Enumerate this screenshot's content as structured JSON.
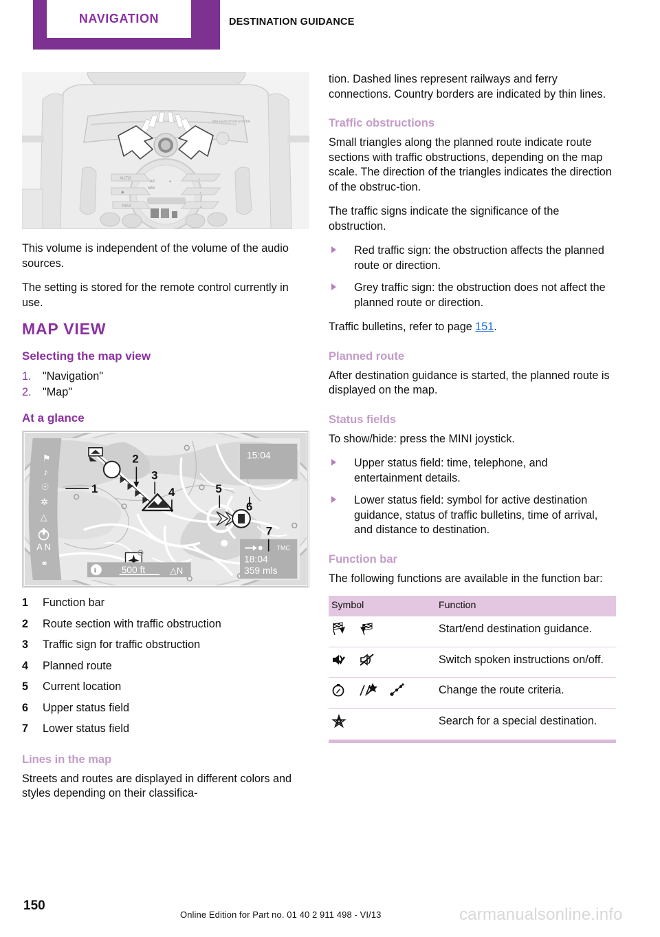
{
  "header": {
    "chapter": "NAVIGATION",
    "section": "DESTINATION GUIDANCE",
    "accent_color": "#7d3292",
    "heading_color": "#8a31a0",
    "subheading_color": "#c49bc8"
  },
  "left_column": {
    "figure_dashboard_caption": "",
    "paragraphs": [
      "This volume is independent of the volume of the audio sources.",
      "The setting is stored for the remote control currently in use."
    ],
    "h1": "MAP VIEW",
    "h2_selecting": "Selecting the map view",
    "steps": [
      {
        "num": "1.",
        "text": "\"Navigation\""
      },
      {
        "num": "2.",
        "text": "\"Map\""
      }
    ],
    "h2_glance": "At a glance",
    "map_image": {
      "upper_status_time": "15:04",
      "scale_label": "500 ft",
      "north_label": "N",
      "lower_status_tmc": "TMC",
      "lower_status_time": "18:04",
      "lower_status_distance": "359 mls",
      "callouts": [
        "1",
        "2",
        "3",
        "4",
        "5",
        "6",
        "7"
      ]
    },
    "legend": [
      {
        "num": "1",
        "label": "Function bar"
      },
      {
        "num": "2",
        "label": "Route section with traffic obstruction"
      },
      {
        "num": "3",
        "label": "Traffic sign for traffic obstruction"
      },
      {
        "num": "4",
        "label": "Planned route"
      },
      {
        "num": "5",
        "label": "Current location"
      },
      {
        "num": "6",
        "label": "Upper status field"
      },
      {
        "num": "7",
        "label": "Lower status field"
      }
    ],
    "h3_lines": "Lines in the map",
    "lines_paragraph": "Streets and routes are displayed in different colors and styles depending on their classifica-"
  },
  "right_column": {
    "continued_paragraph": "tion. Dashed lines represent railways and ferry connections. Country borders are indicated by thin lines.",
    "h3_traffic": "Traffic obstructions",
    "traffic_p1": "Small triangles along the planned route indicate route sections with traffic obstructions, depending on the map scale. The direction of the triangles indicates the direction of the obstruc-tion.",
    "traffic_p2": "The traffic signs indicate the significance of the obstruction.",
    "traffic_bullets": [
      "Red traffic sign: the obstruction affects the planned route or direction.",
      "Grey traffic sign: the obstruction does not affect the planned route or direction."
    ],
    "bulletins_prefix": "Traffic bulletins, refer to page ",
    "bulletins_page": "151",
    "bulletins_suffix": ".",
    "h3_planned": "Planned route",
    "planned_p": "After destination guidance is started, the planned route is displayed on the map.",
    "h3_status": "Status fields",
    "status_p": "To show/hide: press the MINI joystick.",
    "status_bullets": [
      "Upper status field: time, telephone, and entertainment details.",
      "Lower status field: symbol for active destination guidance, status of traffic bulletins, time of arrival, and distance to destination."
    ],
    "h3_function": "Function bar",
    "function_p": "The following functions are available in the function bar:",
    "table": {
      "headers": {
        "symbol": "Symbol",
        "function": "Function"
      },
      "rows": [
        {
          "symbols": [
            "checkered-flags-start-icon",
            "checkered-flags-end-icon"
          ],
          "function": "Start/end destination guidance."
        },
        {
          "symbols": [
            "speaker-on-icon",
            "speaker-off-icon"
          ],
          "function": "Switch spoken instructions on/off."
        },
        {
          "symbols": [
            "compass-icon",
            "route-criteria-icon",
            "shortest-route-icon"
          ],
          "function": "Change the route criteria."
        },
        {
          "symbols": [
            "special-destination-star-icon"
          ],
          "function": "Search for a special destination."
        }
      ]
    }
  },
  "footer": {
    "page_number": "150",
    "edition": "Online Edition for Part no. 01 40 2 911 498 - VI/13",
    "watermark": "carmanualsonline.info"
  }
}
